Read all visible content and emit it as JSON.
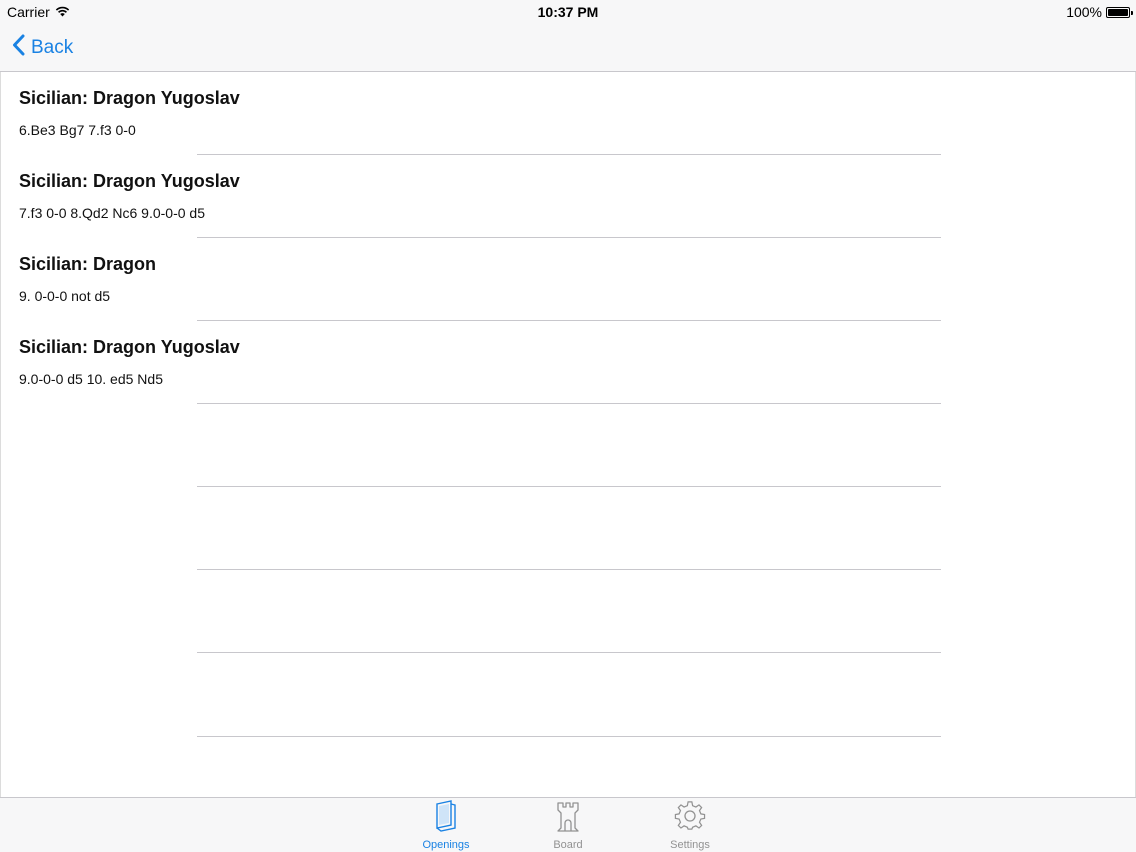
{
  "status_bar": {
    "carrier": "Carrier",
    "time": "10:37 PM",
    "battery": "100%"
  },
  "nav": {
    "back_label": "Back"
  },
  "openings": [
    {
      "title": "Sicilian: Dragon Yugoslav",
      "moves": "6.Be3 Bg7 7.f3 0-0"
    },
    {
      "title": "Sicilian: Dragon Yugoslav",
      "moves": "7.f3 0-0 8.Qd2 Nc6 9.0-0-0 d5"
    },
    {
      "title": "Sicilian: Dragon",
      "moves": "9. 0-0-0 not d5"
    },
    {
      "title": "Sicilian: Dragon Yugoslav",
      "moves": "9.0-0-0 d5 10. ed5 Nd5"
    }
  ],
  "tab_bar": {
    "tabs": [
      {
        "label": "Openings",
        "icon": "book-icon",
        "active": true
      },
      {
        "label": "Board",
        "icon": "rook-icon",
        "active": false
      },
      {
        "label": "Settings",
        "icon": "gear-icon",
        "active": false
      }
    ]
  },
  "colors": {
    "accent": "#1a82e3",
    "inactive": "#929292",
    "separator": "#c8c7cc",
    "bar_background": "#f7f7f8"
  }
}
